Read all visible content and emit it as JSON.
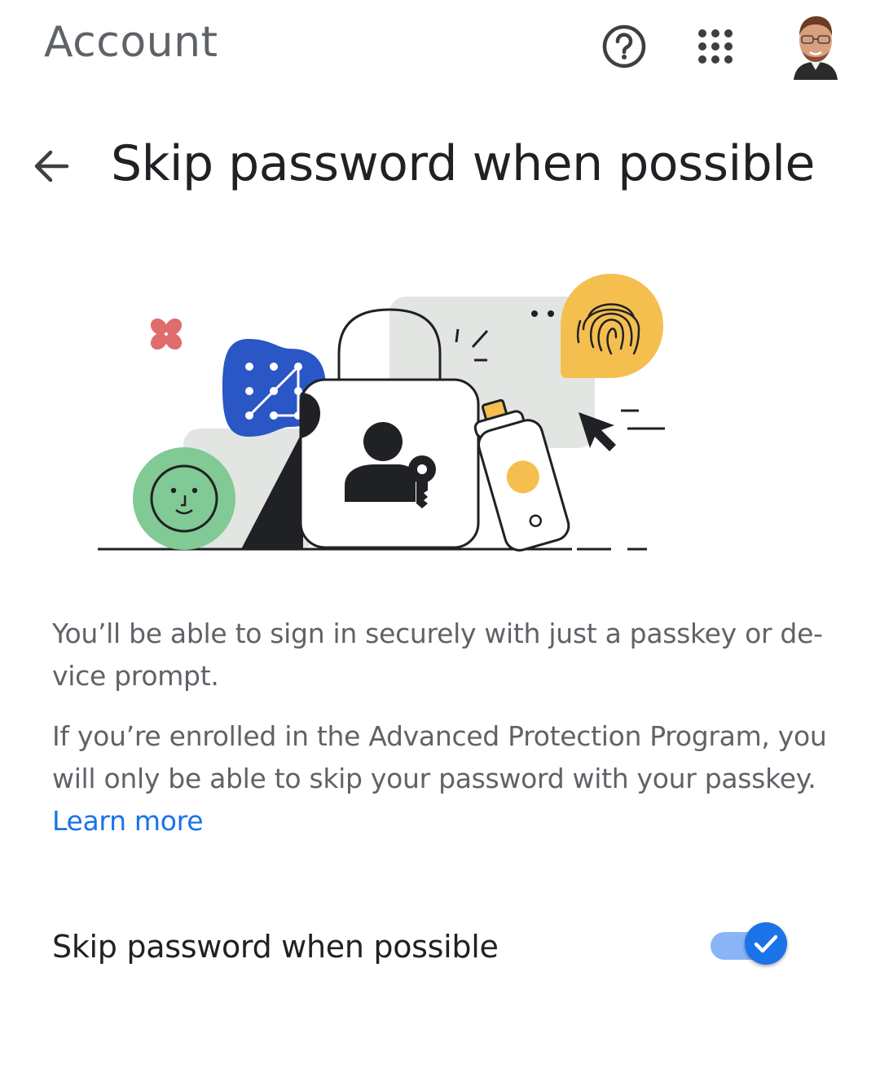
{
  "header": {
    "app_title": "Account",
    "help_icon": "help-circle-icon",
    "apps_icon": "apps-grid-icon",
    "avatar": "user-avatar"
  },
  "page": {
    "back_icon": "arrow-back-icon",
    "title": "Skip password when possible"
  },
  "hero": {
    "accent_colors": {
      "blue": "#2a56c6",
      "green": "#81c995",
      "yellow": "#f4bf4f",
      "red": "#e06c6c",
      "gray": "#e3e5e3"
    }
  },
  "description": {
    "paragraph1": "You’ll be able to sign in securely with just a passkey or de-vice prompt.",
    "paragraph2_text": "If you’re enrolled in the Advanced Protection Program, you will only be able to skip your password with your passkey.",
    "learn_more": "Learn more"
  },
  "setting": {
    "label": "Skip password when possible",
    "enabled": true,
    "toggle_color": "#1a73e8"
  }
}
